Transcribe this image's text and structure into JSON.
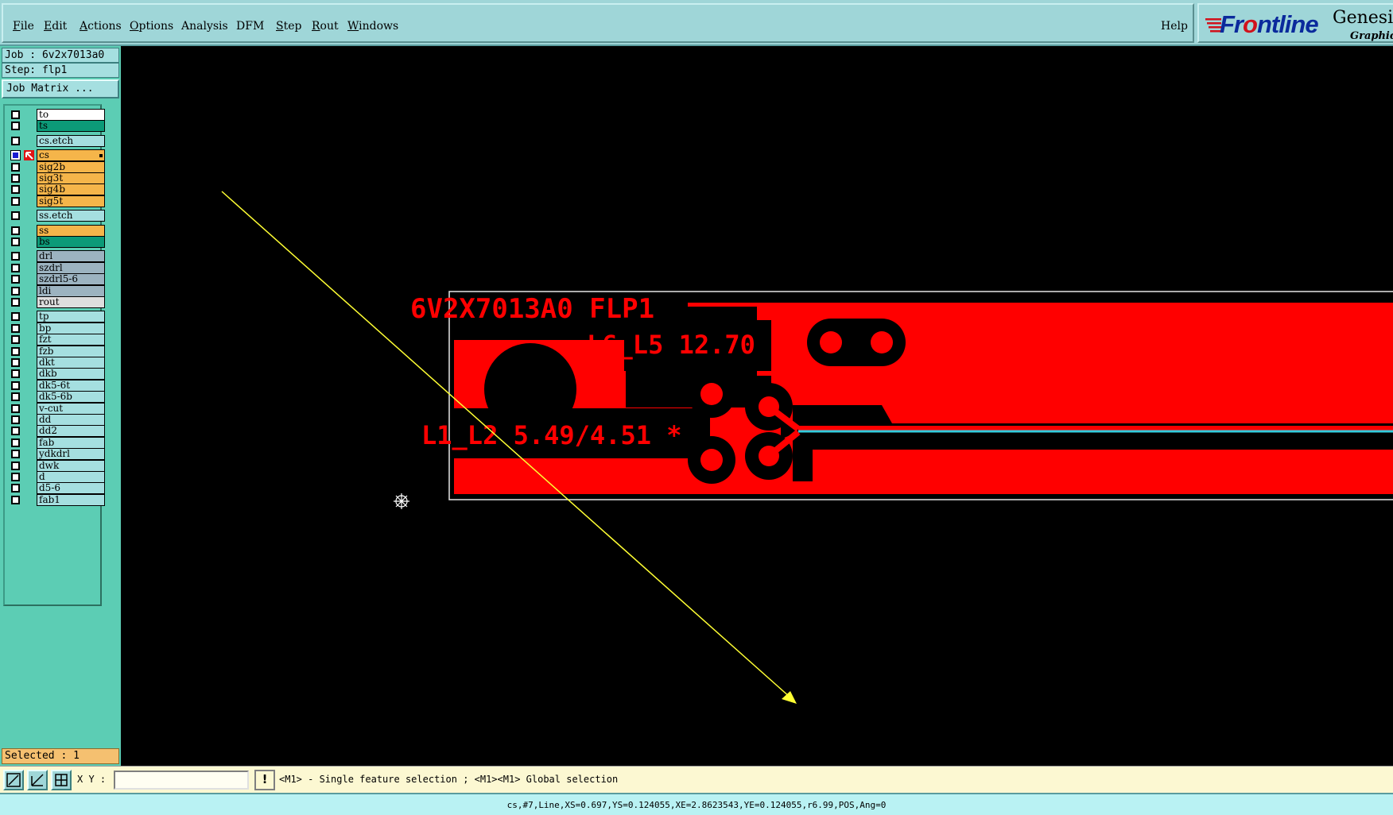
{
  "menu": {
    "items": [
      {
        "label": "File",
        "ul": "F",
        "rest": "ile"
      },
      {
        "label": "Edit",
        "ul": "E",
        "rest": "dit"
      },
      {
        "label": "Actions",
        "ul": "A",
        "rest": "ctions"
      },
      {
        "label": "Options",
        "ul": "O",
        "rest": "ptions"
      },
      {
        "label": "Analysis",
        "ul": "",
        "rest": "Analysis"
      },
      {
        "label": "DFM",
        "ul": "",
        "rest": "DFM"
      },
      {
        "label": "Step",
        "ul": "S",
        "rest": "tep"
      },
      {
        "label": "Rout",
        "ul": "R",
        "rest": "out"
      },
      {
        "label": "Windows",
        "ul": "W",
        "rest": "indows"
      }
    ],
    "help": "Help"
  },
  "brand": {
    "logo_pre": "Fr",
    "logo_o": "o",
    "logo_post": "ntline",
    "product": "Genesis",
    "subtitle": "Graphic"
  },
  "job": {
    "job_line": "Job : 6v2x7013a0",
    "step_line": "Step: flp1",
    "matrix_button": "Job Matrix ..."
  },
  "layers": [
    {
      "name": "to",
      "color": "#ffffff"
    },
    {
      "name": "ts",
      "color": "#0c9a78"
    },
    {
      "name": "cs.etch",
      "color": "#a5dfe0"
    },
    {
      "name": "cs",
      "color": "#f5b54a",
      "active": true
    },
    {
      "name": "sig2b",
      "color": "#f5b54a"
    },
    {
      "name": "sig3t",
      "color": "#f5b54a"
    },
    {
      "name": "sig4b",
      "color": "#f5b54a"
    },
    {
      "name": "sig5t",
      "color": "#f5b54a"
    },
    {
      "name": "ss.etch",
      "color": "#a5dfe0"
    },
    {
      "name": "ss",
      "color": "#f5b54a"
    },
    {
      "name": "bs",
      "color": "#0c9a78"
    },
    {
      "name": "drl",
      "color": "#9cb3c0"
    },
    {
      "name": "szdrl",
      "color": "#9cb3c0"
    },
    {
      "name": "szdrl5-6",
      "color": "#9cb3c0"
    },
    {
      "name": "ldi",
      "color": "#9cb3c0"
    },
    {
      "name": "rout",
      "color": "#dedede"
    },
    {
      "name": "tp",
      "color": "#a5dfe0"
    },
    {
      "name": "bp",
      "color": "#a5dfe0"
    },
    {
      "name": "fzt",
      "color": "#a5dfe0"
    },
    {
      "name": "fzb",
      "color": "#a5dfe0"
    },
    {
      "name": "dkt",
      "color": "#a5dfe0"
    },
    {
      "name": "dkb",
      "color": "#a5dfe0"
    },
    {
      "name": "dk5-6t",
      "color": "#a5dfe0"
    },
    {
      "name": "dk5-6b",
      "color": "#a5dfe0"
    },
    {
      "name": "v-cut",
      "color": "#a5dfe0"
    },
    {
      "name": "dd",
      "color": "#a5dfe0"
    },
    {
      "name": "dd2",
      "color": "#a5dfe0"
    },
    {
      "name": "fab",
      "color": "#a5dfe0"
    },
    {
      "name": "ydkdrl",
      "color": "#a5dfe0"
    },
    {
      "name": "dwk",
      "color": "#a5dfe0"
    },
    {
      "name": "d",
      "color": "#a5dfe0"
    },
    {
      "name": "d5-6",
      "color": "#a5dfe0"
    },
    {
      "name": "fab1",
      "color": "#a5dfe0"
    }
  ],
  "selected": "Selected : 1",
  "board": {
    "title": "6V2X7013A0 FLP1",
    "label_l6": "L6_L5 12.70 *",
    "label_l1": "L1_L2 5.49/4.51 *",
    "copper_color": "#ff0000",
    "trace_color": "#33ccdd",
    "measure_color": "#ffff33"
  },
  "toolbar": {
    "xy_label": "X Y :",
    "xy_value": "",
    "excl": "!",
    "hint": "<M1> - Single feature selection ; <M1><M1> Global selection"
  },
  "status": "cs,#7,Line,XS=0.697,YS=0.124055,XE=2.8623543,YE=0.124055,r6.99,POS,Ang=0"
}
